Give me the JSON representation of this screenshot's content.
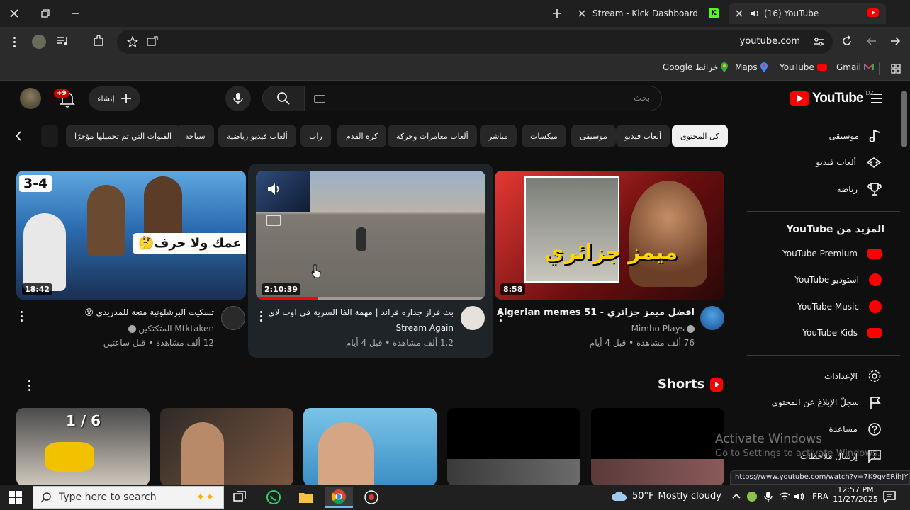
{
  "browser": {
    "tabs": [
      {
        "title": "Stream - Kick Dashboard"
      },
      {
        "title": "(16) YouTube"
      }
    ],
    "url": "youtube.com",
    "bookmarks": [
      {
        "label": "Google خرائط"
      },
      {
        "label": "Maps"
      },
      {
        "label": "YouTube"
      },
      {
        "label": "Gmail"
      }
    ]
  },
  "youtube": {
    "logo_text": "YouTube",
    "logo_region": "DZ",
    "search_placeholder": "بحث",
    "create_label": "إنشاء",
    "notification_badge": "+9",
    "chips": [
      {
        "label": "كل المحتوى",
        "selected": true
      },
      {
        "label": "ألعاب فيديو"
      },
      {
        "label": "موسيقى"
      },
      {
        "label": "ميكسات"
      },
      {
        "label": "مباشر"
      },
      {
        "label": "ألعاب مغامرات وحركة"
      },
      {
        "label": "كرة القدم"
      },
      {
        "label": "راب"
      },
      {
        "label": "ألعاب فيديو رياضية"
      },
      {
        "label": "سياحة"
      },
      {
        "label": "الفنوات التي تم تحميلها مؤخرًا"
      }
    ],
    "videos": [
      {
        "duration": "8:58",
        "title": "افضل ميمز جزائري - Algerian memes 51",
        "channel": "Mimho Plays",
        "meta": "76 ألف مشاهدة • قبل 4 أيام",
        "thumb_text": "ميمز جزائري"
      },
      {
        "duration": "2:10:39",
        "title": "بث فراز جداره قراند | مهمة الفا السرية في اوت لاي",
        "channel": "Stream Again",
        "meta": "1.2 ألف مشاهدة • قبل 4 أيام",
        "progress": 0.27
      },
      {
        "duration": "18:42",
        "title": "تسكيت البرشلونية متعة للمدريدي 😮",
        "channel": "المتكتكين Mtktaken",
        "meta": "12 ألف مشاهدة • قبل ساعتين",
        "thumb_text": "مبابي عمك ولا حرف🤔",
        "score": "3-4"
      }
    ],
    "shorts_title": "Shorts",
    "shorts_first_overlay": "1 / 6",
    "sidebar": {
      "items_top": [
        {
          "label": "موسيقى",
          "icon": "music-note-icon"
        },
        {
          "label": "ألعاب فيديو",
          "icon": "gamepad-icon"
        },
        {
          "label": "رياضة",
          "icon": "trophy-icon"
        }
      ],
      "more_heading": "المزيد من YouTube",
      "more_items": [
        {
          "label": "YouTube Premium"
        },
        {
          "label": "استوديو YouTube"
        },
        {
          "label": "YouTube Music"
        },
        {
          "label": "YouTube Kids"
        }
      ],
      "settings_items": [
        {
          "label": "الإعدادات",
          "icon": "gear-icon"
        },
        {
          "label": "سجلّ الإبلاغ عن المحتوى",
          "icon": "flag-icon"
        },
        {
          "label": "مساعدة",
          "icon": "help-icon"
        },
        {
          "label": "إرسال ملاحظات",
          "icon": "feedback-icon"
        }
      ]
    }
  },
  "status_url": "https://www.youtube.com/watch?v=7K9gvERihJY",
  "activate": {
    "title": "Activate Windows",
    "subtitle": "Go to Settings to activate Windows."
  },
  "taskbar": {
    "search_placeholder": "Type here to search",
    "weather_temp": "50°F",
    "weather_text": "Mostly cloudy",
    "lang": "FRA",
    "time": "12:57 PM",
    "date": "11/27/2025"
  }
}
